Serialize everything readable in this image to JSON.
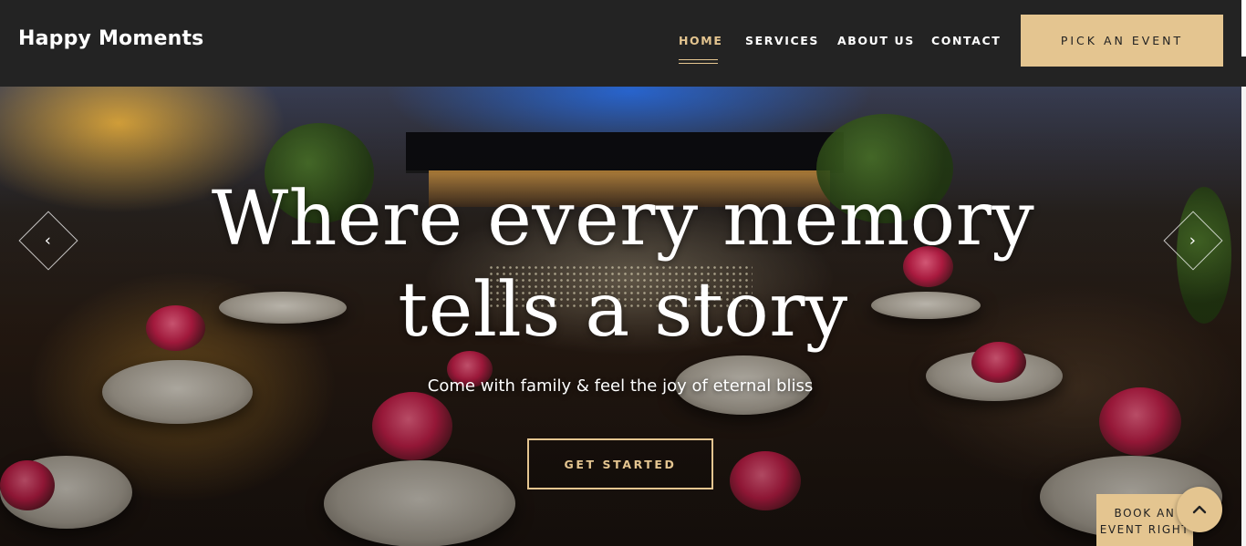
{
  "header": {
    "brand": "Happy Moments",
    "nav": [
      {
        "label": "HOME",
        "active": true
      },
      {
        "label": "SERVICES",
        "active": false
      },
      {
        "label": "ABOUT US",
        "active": false
      },
      {
        "label": "CONTACT",
        "active": false
      }
    ],
    "cta_label": "PICK AN EVENT"
  },
  "hero": {
    "title_line1": "Where every memory",
    "title_line2": "tells a story",
    "subtitle": "Come with family & feel the joy of eternal bliss",
    "button_label": "GET STARTED",
    "prev_icon": "chevron-left-icon",
    "next_icon": "chevron-right-icon"
  },
  "floating": {
    "book_label": "BOOK AN EVENT RIGHT",
    "scroll_top_icon": "chevron-up-icon"
  },
  "colors": {
    "accent": "#e4c590",
    "header_bg": "#232323",
    "text_light": "#ffffff"
  }
}
